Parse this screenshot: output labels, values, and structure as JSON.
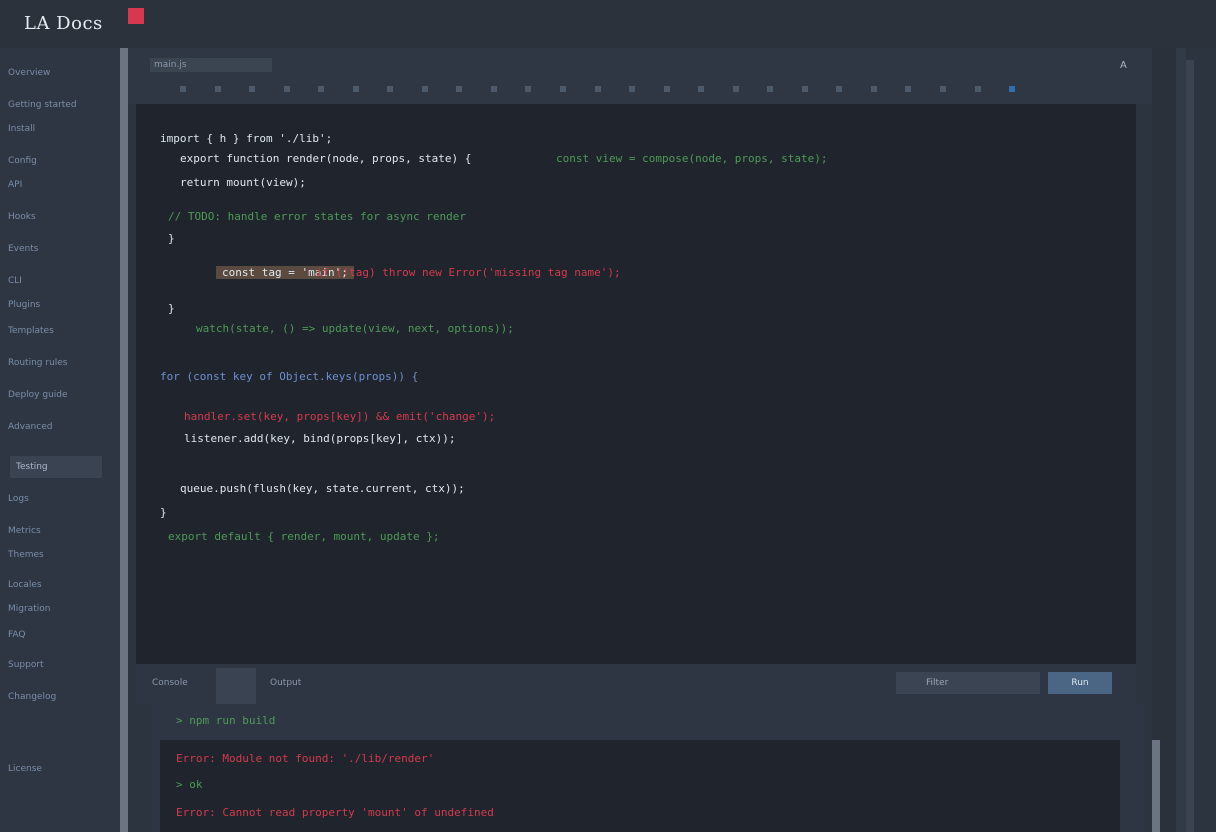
{
  "app": {
    "logo_text": "LA Docs",
    "accent": "#d8384e"
  },
  "sidebar": {
    "items": [
      {
        "label": "Overview"
      },
      {
        "label": "Getting started"
      },
      {
        "label": "Install"
      },
      {
        "label": "Config"
      },
      {
        "label": "API"
      },
      {
        "label": "Hooks"
      },
      {
        "label": "Events"
      },
      {
        "label": "CLI"
      },
      {
        "label": "Plugins"
      },
      {
        "label": "Templates"
      },
      {
        "label": "Routing rules"
      },
      {
        "label": "Deploy guide"
      },
      {
        "label": "Advanced"
      },
      {
        "label": "Testing"
      },
      {
        "label": "Logs"
      },
      {
        "label": "Metrics"
      },
      {
        "label": "Themes"
      },
      {
        "label": "Locales"
      },
      {
        "label": "Migration"
      },
      {
        "label": "FAQ"
      },
      {
        "label": "Support"
      },
      {
        "label": "Changelog"
      },
      {
        "label": "License"
      }
    ],
    "active_index": 12
  },
  "toolbar": {
    "tab_label": "main.js",
    "right_label": "A"
  },
  "editor": {
    "lines": [
      {
        "text": "import { h } from './lib';",
        "color": "white"
      },
      {
        "text": "export function render(node, props, state) {",
        "color": "white"
      },
      {
        "text": "  const view = compose(node, props, state);",
        "color": "green"
      },
      {
        "text": "  return mount(view);",
        "color": "white"
      },
      {
        "text": "// TODO: handle error states for async render",
        "color": "green"
      },
      {
        "text": "}",
        "color": "white"
      },
      {
        "text": "const tag = 'main';",
        "color": "highlight"
      },
      {
        "text": "if (!tag) throw new Error('missing tag name');",
        "color": "red"
      },
      {
        "text": "}",
        "color": "white"
      },
      {
        "text": "watch(state, () => update(view, next, options));",
        "color": "green"
      },
      {
        "text": "for (const key of Object.keys(props)) {",
        "color": "blue"
      },
      {
        "text": "  handler.set(key, props[key]) && emit('change');",
        "color": "red"
      },
      {
        "text": "  listener.add(key, bind(props[key], ctx));",
        "color": "white"
      },
      {
        "text": "  queue.push(flush(key, state.current, ctx));",
        "color": "white"
      },
      {
        "text": "}",
        "color": "white"
      },
      {
        "text": "export default { render, mount, update };",
        "color": "green"
      }
    ]
  },
  "bottom": {
    "label1": "Console",
    "label2": "Output",
    "input_placeholder": "Filter",
    "run_button": "Run"
  },
  "console": {
    "lines": [
      {
        "text": "> npm run build",
        "color": "green"
      },
      {
        "text": "Error: Module not found: './lib/render'",
        "color": "red"
      },
      {
        "text": "> ok",
        "color": "green"
      },
      {
        "text": "Error: Cannot read property 'mount' of undefined",
        "color": "red"
      }
    ]
  }
}
